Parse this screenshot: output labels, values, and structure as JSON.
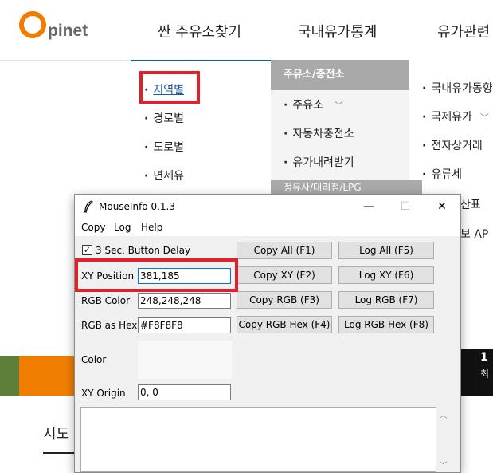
{
  "site": {
    "logo_o": "O",
    "logo_text": "pinet",
    "nav": [
      "싼 주유소찾기",
      "국내유가통계",
      "유가관련"
    ],
    "col1_items": [
      "지역별",
      "경로별",
      "도로별",
      "면세유"
    ],
    "col2_heading": "주유소/충전소",
    "col2_items": [
      "주유소",
      "자동차충전소",
      "유가내려받기"
    ],
    "col2_heading2": "정유사/대리점/LPG",
    "col3_items": [
      "국내유가동향",
      "국제유가",
      "전자상거래",
      "유류세"
    ],
    "right_partial": [
      "산표",
      "보 AP"
    ],
    "dark_band_text": [
      "1",
      "최"
    ],
    "sido_text": "시도"
  },
  "window": {
    "title": "MouseInfo 0.1.3",
    "minimize": "—",
    "maximize": "☐",
    "close": "✕",
    "menu": [
      "Copy",
      "Log",
      "Help"
    ],
    "delay_checkbox_label": "3 Sec. Button Delay",
    "delay_checked": true,
    "labels": {
      "xy_position": "XY Position",
      "rgb_color": "RGB Color",
      "rgb_hex": "RGB as Hex",
      "color": "Color",
      "xy_origin": "XY Origin"
    },
    "values": {
      "xy_position": "381,185",
      "rgb_color": "248,248,248",
      "rgb_hex": "#F8F8F8",
      "xy_origin": "0, 0"
    },
    "buttons": {
      "copy_all": "Copy All (F1)",
      "log_all": "Log All (F5)",
      "copy_xy": "Copy XY (F2)",
      "log_xy": "Log XY (F6)",
      "copy_rgb": "Copy RGB (F3)",
      "log_rgb": "Log RGB (F7)",
      "copy_rgb_hex": "Copy RGB Hex (F4)",
      "log_rgb_hex": "Log RGB Hex (F8)"
    },
    "swatch_color": "#F8F8F8"
  },
  "colors": {
    "brand_orange": "#f07d00",
    "highlight_red": "#e0202a",
    "link_blue": "#1c58a4"
  }
}
